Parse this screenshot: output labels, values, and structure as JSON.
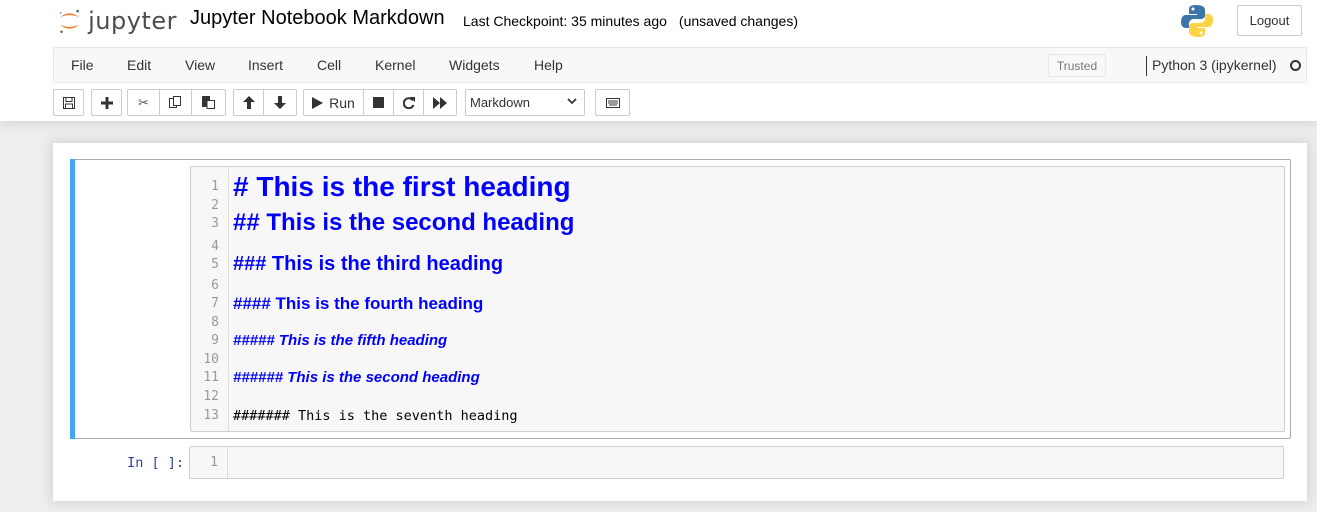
{
  "header": {
    "logo_text": "jupyter",
    "notebook_title": "Jupyter Notebook Markdown",
    "checkpoint": "Last Checkpoint: 35 minutes ago",
    "autosave_status": "(unsaved changes)",
    "logout_label": "Logout"
  },
  "menubar": {
    "items": [
      "File",
      "Edit",
      "View",
      "Insert",
      "Cell",
      "Kernel",
      "Widgets",
      "Help"
    ],
    "trusted_label": "Trusted",
    "kernel_name": "Python 3 (ipykernel)",
    "kernel_status": "idle"
  },
  "toolbar": {
    "buttons": [
      {
        "name": "save",
        "icon": "floppy-icon"
      },
      {
        "name": "insert-cell-below",
        "icon": "plus-icon"
      },
      {
        "name": "cut",
        "icon": "scissors-icon"
      },
      {
        "name": "copy",
        "icon": "copy-icon"
      },
      {
        "name": "paste",
        "icon": "paste-icon"
      },
      {
        "name": "move-up",
        "icon": "arrow-up-icon"
      },
      {
        "name": "move-down",
        "icon": "arrow-down-icon"
      },
      {
        "name": "run",
        "icon": "play-icon"
      },
      {
        "name": "interrupt",
        "icon": "stop-icon"
      },
      {
        "name": "restart",
        "icon": "refresh-icon"
      },
      {
        "name": "restart-run-all",
        "icon": "fast-forward-icon"
      },
      {
        "name": "command-palette",
        "icon": "keyboard-icon"
      }
    ],
    "run_label": "Run",
    "cell_type_selected": "Markdown"
  },
  "cells": {
    "markdown": {
      "lines": [
        {
          "num": "1",
          "text": "# This is the first heading"
        },
        {
          "num": "2",
          "text": ""
        },
        {
          "num": "3",
          "text": "## This is the second heading"
        },
        {
          "num": "4",
          "text": ""
        },
        {
          "num": "5",
          "text": "### This is the third heading"
        },
        {
          "num": "6",
          "text": ""
        },
        {
          "num": "7",
          "text": "#### This is the fourth heading"
        },
        {
          "num": "8",
          "text": ""
        },
        {
          "num": "9",
          "text": "##### This is the fifth heading"
        },
        {
          "num": "10",
          "text": ""
        },
        {
          "num": "11",
          "text": "###### This is the second heading"
        },
        {
          "num": "12",
          "text": ""
        },
        {
          "num": "13",
          "text": "####### This is the seventh heading"
        }
      ]
    },
    "code": {
      "prompt": "In [ ]:",
      "line_num": "1",
      "content": ""
    }
  },
  "colors": {
    "selected_cell_bar": "#42a5f5",
    "markdown_heading": "#0000ff",
    "prompt": "#303f9f",
    "logo_orange": "#f37726"
  }
}
